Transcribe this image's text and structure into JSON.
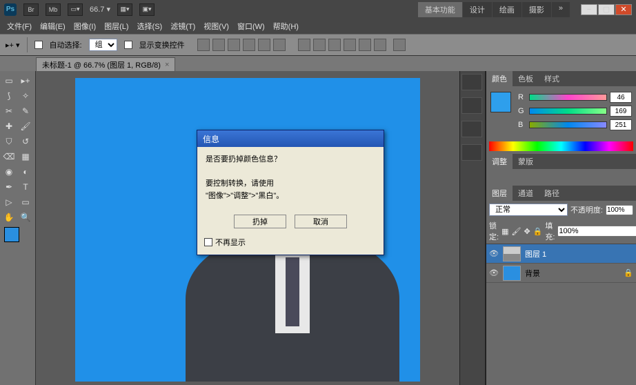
{
  "top": {
    "zoom": "66.7",
    "logo": "Ps",
    "br": "Br",
    "mb": "Mb"
  },
  "workspaces": {
    "basic": "基本功能",
    "design": "设计",
    "paint": "绘画",
    "photo": "摄影"
  },
  "menu": {
    "file": "文件(F)",
    "edit": "编辑(E)",
    "image": "图像(I)",
    "layer": "图层(L)",
    "select": "选择(S)",
    "filter": "滤镜(T)",
    "view": "视图(V)",
    "window": "窗口(W)",
    "help": "帮助(H)"
  },
  "options": {
    "autosel_label": "自动选择:",
    "autosel_combo": "组",
    "showtransform_label": "显示变换控件"
  },
  "doctab": {
    "title": "未标题-1 @ 66.7% (图层 1, RGB/8)"
  },
  "dialog": {
    "title": "信息",
    "line1": "是否要扔掉颜色信息？",
    "line2": "要控制转换，请使用",
    "line3": "\"图像\">\"调整\">\"黑白\"。",
    "discard": "扔掉",
    "cancel": "取消",
    "noagain": "不再显示"
  },
  "panels": {
    "color_tab": "颜色",
    "swatches_tab": "色板",
    "styles_tab": "样式",
    "r_val": "46",
    "g_val": "169",
    "b_val": "251",
    "adj_tab": "调整",
    "mat_tab": "蒙版",
    "layers_tab": "图层",
    "channels_tab": "通道",
    "paths_tab": "路径",
    "blend": "正常",
    "opacity_label": "不透明度:",
    "opacity_val": "100%",
    "lock_label": "锁定:",
    "fill_label": "填充:",
    "fill_val": "100%",
    "layer1": "图层 1",
    "bg_layer": "背景"
  }
}
